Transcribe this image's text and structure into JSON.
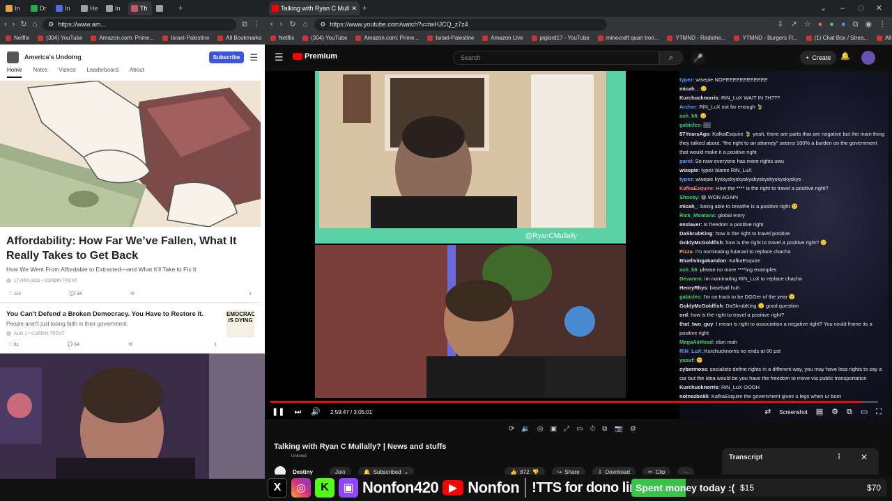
{
  "left_browser": {
    "tabs": [
      {
        "label": "In",
        "color": "#e8a33b"
      },
      {
        "label": "Dr",
        "color": "#2aa84a"
      },
      {
        "label": "In",
        "color": "#4a6ee0"
      },
      {
        "label": "He",
        "color": "#9aa0a6"
      },
      {
        "label": "In",
        "color": "#9aa0a6"
      },
      {
        "label": "Th",
        "color": "#c2566b"
      },
      {
        "label": "",
        "color": "#9aa0a6"
      }
    ],
    "url": "https://www.am...",
    "bookmarks": [
      "Netflix",
      "(304) YouTube",
      "Amazon.com: Prime...",
      "Israel-Palestine",
      "All Bookmarks"
    ],
    "substack": {
      "pub_name": "America's Undoing",
      "subscribe": "Subscribe",
      "nav": [
        "Home",
        "Notes",
        "Videos",
        "Leaderboard",
        "About"
      ],
      "article1": {
        "title": "Affordability: How Far We’ve Fallen, What It Really Takes to Get Back",
        "subtitle": "How We Went From Affordable to Extracted—and What It’ll Take to Fix It",
        "meta": "17 HRS AGO • CORBIN TRENT",
        "likes": "114",
        "comments": "34"
      },
      "article2": {
        "title": "You Can't Defend a Broken Democracy. You Have to Restore It.",
        "subtitle": "People aren't just losing faith in their government.",
        "meta": "AUG 1 • CORBIN TRENT",
        "likes": "91",
        "comments": "64",
        "thumb_text": "EMOCRAC IS DYING"
      }
    }
  },
  "right_browser": {
    "tab_title": "Talking with Ryan C Mullall",
    "url": "https://www.youtube.com/watch?v=twHJCQ_z7z4",
    "bookmarks": [
      "Netflix",
      "(304) YouTube",
      "Amazon.com: Prime...",
      "Israel-Palestine",
      "Amazon Live",
      "piglord17 - YouTube",
      "minecraft quan tron...",
      "YTMND - Radiohe...",
      "YTMND - Burgers Fl...",
      "(1) Chat Box / Strea...",
      "All Bookmarks"
    ],
    "youtube": {
      "logo": "Premium",
      "search_placeholder": "Search",
      "create": "Create",
      "time": "2:59:47 / 3:05:01",
      "progress": 0.973,
      "watermark": "@RyanCMullally",
      "screenshot_label": "Screenshot",
      "title": "Talking with Ryan C Mullally? | News and stuffs",
      "unlisted": "Unlisted",
      "channel": "Destiny",
      "join": "Join",
      "subscribed": "Subscribed",
      "likes": "872",
      "share": "Share",
      "download": "Download",
      "clip": "Clip",
      "transcript": "Transcript"
    },
    "chat": [
      {
        "user": "typez",
        "color": "#5aa0ff",
        "msg": "wisepie NOPEEEEEEEEEEEE"
      },
      {
        "user": "micah_",
        "color": "#e8e8e8",
        "msg": "🙂"
      },
      {
        "user": "Kurchucknorris",
        "color": "#e8e8e8",
        "msg": "RiN_LuX WAIT IN 7H???"
      },
      {
        "user": "Archer",
        "color": "#5aa0ff",
        "msg": "RiN_LuX not far enough 🍃"
      },
      {
        "user": "ash_k6",
        "color": "#3ad46a",
        "msg": "🙂"
      },
      {
        "user": "gabicles",
        "color": "#3ad46a",
        "msg": "▒▒"
      },
      {
        "user": "87YearsAgo",
        "color": "#e8e8e8",
        "msg": "KafkaEsquire 🍃 yeah, there are parts that are negative but the main thing they talked about, \"the right to an attorney\" seems 100% a burden on the government that would make it a positive right"
      },
      {
        "user": "parol",
        "color": "#5aa0ff",
        "msg": "So now everyone has more rights uwu"
      },
      {
        "user": "wisepie",
        "color": "#e8e8e8",
        "msg": "typez blame RiN_LuX"
      },
      {
        "user": "typez",
        "color": "#5aa0ff",
        "msg": "wisepie kyskyskyskyskyskyskyskyskyskyskys"
      },
      {
        "user": "KafkaEsquire",
        "color": "#ff7a7a",
        "msg": "How the **** is the right to travel a positive right?"
      },
      {
        "user": "Shocky",
        "color": "#3ad46a",
        "msg": "😆 WON AGAIN"
      },
      {
        "user": "micah_",
        "color": "#e8e8e8",
        "msg": "being able to breathe is a positive right 🙂"
      },
      {
        "user": "Rick_Montana",
        "color": "#3ad46a",
        "msg": "global entry"
      },
      {
        "user": "enslaver",
        "color": "#e8e8e8",
        "msg": "Is freedom a positive right"
      },
      {
        "user": "DaSkrubKing",
        "color": "#e8e8e8",
        "msg": "how is the right to travel positive"
      },
      {
        "user": "GoldyMcGoldfish",
        "color": "#e8e8e8",
        "msg": "how is the right to travel a positive right? 🙂"
      },
      {
        "user": "Pizza",
        "color": "#e8b03a",
        "msg": "i'm nominating futanari to replace chacha"
      },
      {
        "user": "Bluelivingabandon",
        "color": "#e8e8e8",
        "msg": "KafkaEsquire"
      },
      {
        "user": "ash_k6",
        "color": "#3ad46a",
        "msg": "please no more ****ing examples"
      },
      {
        "user": "Devannn",
        "color": "#3ad46a",
        "msg": "im nominating RiN_LuX to replace chacha"
      },
      {
        "user": "HenryRhys",
        "color": "#e8e8e8",
        "msg": "baseball huh"
      },
      {
        "user": "gabicles",
        "color": "#3ad46a",
        "msg": "I'm on track to be DGGer of the year 🙂"
      },
      {
        "user": "GoldyMcGoldfish",
        "color": "#e8e8e8",
        "msg": "DaSkrubKing 🙂 good question"
      },
      {
        "user": "ord",
        "color": "#e8e8e8",
        "msg": "how is the right to travel a positive right?"
      },
      {
        "user": "that_two_guy",
        "color": "#e8e8e8",
        "msg": "I mean is right to association a negative right? You could frame its a positive right"
      },
      {
        "user": "MegaAirHead",
        "color": "#3ad46a",
        "msg": "elon mah"
      },
      {
        "user": "RiN_LuX",
        "color": "#5aa0ff",
        "msg": "Kurchucknorris no ends at 00 pst"
      },
      {
        "user": "yusuf",
        "color": "#3ad46a",
        "msg": "🙂"
      },
      {
        "user": "cybermoss",
        "color": "#e8e8e8",
        "msg": "socialists define rights in a different way, you may have less rights to say a car but the idea would be you have the freedom to move via public transportation"
      },
      {
        "user": "Kurchucknorris",
        "color": "#e8e8e8",
        "msg": "RiN_LuX OOOH"
      },
      {
        "user": "notnazbo95",
        "color": "#e8e8e8",
        "msg": "KafkaEsquire the government gives u legs when ur born"
      }
    ]
  },
  "overlay": {
    "handle1": "Nonfon420",
    "handle2": "Nonfon",
    "tts": "!TTS for dono link",
    "goal_label": "Spent money today :(",
    "goal_current": "$15",
    "goal_target": "$70",
    "goal_progress": 0.214
  }
}
